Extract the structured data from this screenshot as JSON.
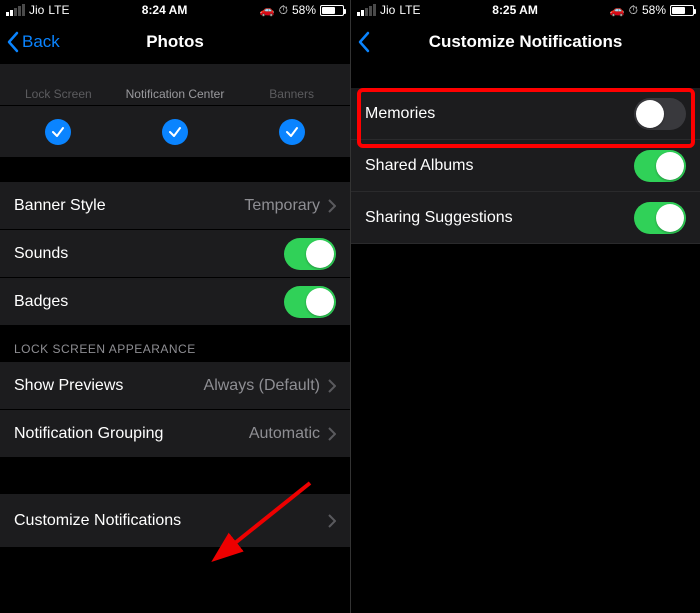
{
  "left": {
    "status": {
      "carrier": "Jio",
      "network": "LTE",
      "time": "8:24 AM",
      "battery_pct": "58%",
      "battery_fill": 58
    },
    "nav": {
      "back": "Back",
      "title": "Photos"
    },
    "alert_labels": {
      "a": "Lock Screen",
      "b": "Notification Center",
      "c": "Banners"
    },
    "rows": {
      "banner_style": {
        "label": "Banner Style",
        "value": "Temporary"
      },
      "sounds": {
        "label": "Sounds"
      },
      "badges": {
        "label": "Badges"
      },
      "section": "LOCK SCREEN APPEARANCE",
      "previews": {
        "label": "Show Previews",
        "value": "Always (Default)"
      },
      "grouping": {
        "label": "Notification Grouping",
        "value": "Automatic"
      },
      "customize": {
        "label": "Customize Notifications"
      }
    }
  },
  "right": {
    "status": {
      "carrier": "Jio",
      "network": "LTE",
      "time": "8:25 AM",
      "battery_pct": "58%",
      "battery_fill": 58
    },
    "nav": {
      "title": "Customize Notifications"
    },
    "rows": {
      "memories": {
        "label": "Memories"
      },
      "shared": {
        "label": "Shared Albums"
      },
      "suggestions": {
        "label": "Sharing Suggestions"
      }
    }
  },
  "icons": {
    "carplay": "🚗",
    "alarm": "⏱"
  }
}
